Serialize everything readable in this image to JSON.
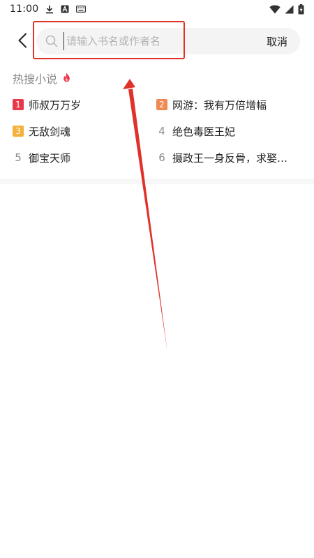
{
  "status_bar": {
    "time": "11:00",
    "icons": [
      "download-icon",
      "text-a-icon",
      "keyboard-icon",
      "wifi-icon",
      "signal-icon",
      "battery-charging-icon"
    ]
  },
  "search": {
    "placeholder": "请输入书名或作者名",
    "value": "",
    "cancel_label": "取消"
  },
  "hot": {
    "title": "热搜小说",
    "icon": "flame-icon",
    "items": [
      {
        "rank": "1",
        "label": "师叔万万岁",
        "badge_color": "#e8394a"
      },
      {
        "rank": "2",
        "label": "网游：我有万倍增幅",
        "badge_color": "#f08a52"
      },
      {
        "rank": "3",
        "label": "无敌剑魂",
        "badge_color": "#f5b13d"
      },
      {
        "rank": "4",
        "label": "绝色毒医王妃",
        "badge_color": ""
      },
      {
        "rank": "5",
        "label": "御宝天师",
        "badge_color": ""
      },
      {
        "rank": "6",
        "label": "摄政王一身反骨，求娶…",
        "badge_color": ""
      }
    ]
  },
  "colors": {
    "accent_red": "#e0322a",
    "flame": "#e8394a"
  }
}
